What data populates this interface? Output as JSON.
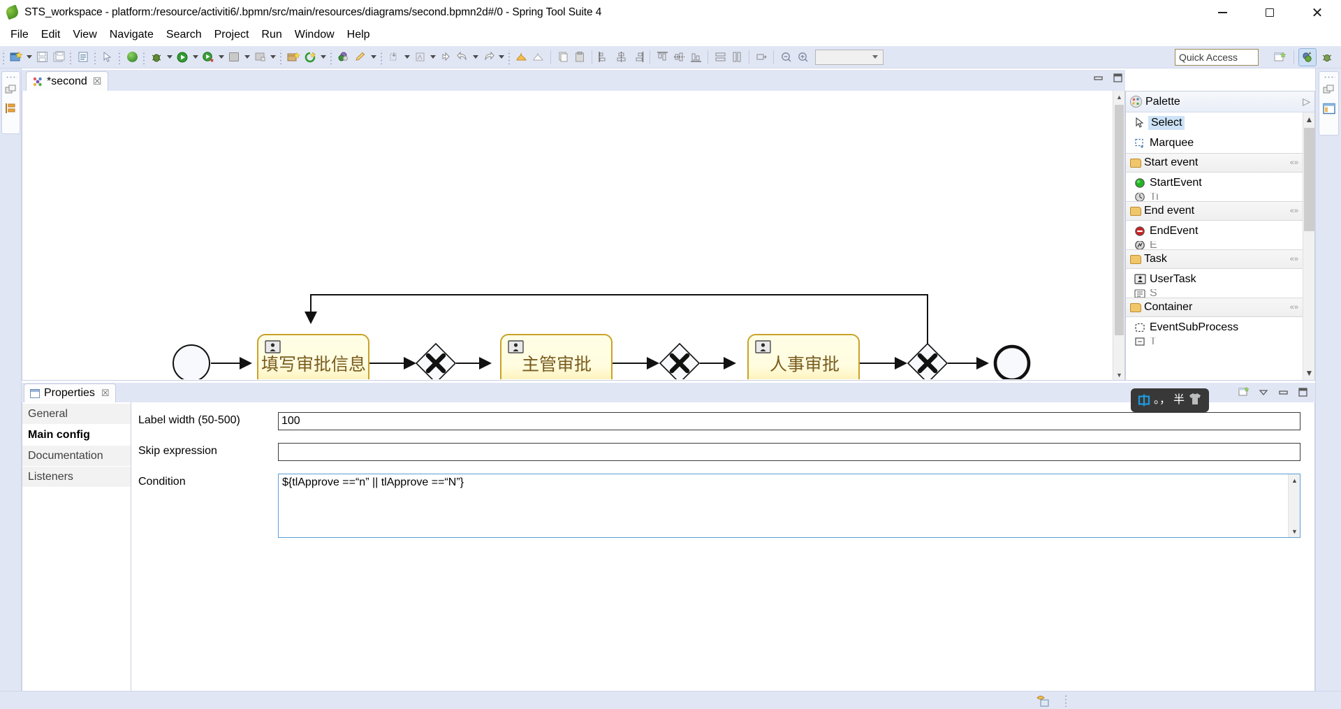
{
  "window": {
    "title": "STS_workspace - platform:/resource/activiti6/.bpmn/src/main/resources/diagrams/second.bpmn2d#/0 - Spring Tool Suite 4",
    "app_icon": "spring-leaf-icon",
    "minimize_label": "Minimize",
    "maximize_label": "Restore",
    "close_label": "Close"
  },
  "menubar": {
    "items": [
      {
        "label": "File"
      },
      {
        "label": "Edit"
      },
      {
        "label": "View"
      },
      {
        "label": "Navigate"
      },
      {
        "label": "Search"
      },
      {
        "label": "Project"
      },
      {
        "label": "Run"
      },
      {
        "label": "Window"
      },
      {
        "label": "Help"
      }
    ]
  },
  "toolbar": {
    "quick_access_placeholder": "Quick Access",
    "zoom_combo_value": "",
    "perspective_icons": [
      "open-perspective-icon",
      "spring-perspective-icon",
      "debug-perspective-icon"
    ]
  },
  "editor": {
    "tab_label": "*second",
    "tab_icon": "bpmn-diagram-icon",
    "tab_close": "☒",
    "minimize_label": "Minimize",
    "maximize_label": "Maximize"
  },
  "diagram": {
    "type": "bpmn-process",
    "nodes": [
      {
        "id": "startEvent1",
        "kind": "start-event",
        "label": ""
      },
      {
        "id": "usertask1",
        "kind": "user-task",
        "label": "填写审批信息"
      },
      {
        "id": "gateway1",
        "kind": "exclusive-gateway",
        "label": ""
      },
      {
        "id": "usertask2",
        "kind": "user-task",
        "label": "主管审批"
      },
      {
        "id": "gateway2",
        "kind": "exclusive-gateway",
        "label": ""
      },
      {
        "id": "usertask3",
        "kind": "user-task",
        "label": "人事审批"
      },
      {
        "id": "gateway3",
        "kind": "exclusive-gateway",
        "label": ""
      },
      {
        "id": "endEvent1",
        "kind": "end-event",
        "label": ""
      },
      {
        "id": "endEvent2",
        "kind": "end-event",
        "label": ""
      }
    ],
    "selected_flow": {
      "id": "selected-sequence-flow",
      "color": "#ff8c00",
      "style": "dashed",
      "from": "gateway2",
      "to": "usertask1"
    }
  },
  "palette": {
    "title": "Palette",
    "title_icon": "palette-icon",
    "expand_icon": "▷",
    "tools": [
      {
        "label": "Select",
        "icon": "cursor-arrow-icon",
        "selected": true
      },
      {
        "label": "Marquee",
        "icon": "marquee-select-icon",
        "selected": false
      }
    ],
    "groups": [
      {
        "name": "Start event",
        "items": [
          {
            "label": "StartEvent",
            "icon": "start-event-icon"
          }
        ]
      },
      {
        "name": "End event",
        "items": [
          {
            "label": "EndEvent",
            "icon": "end-event-icon"
          }
        ]
      },
      {
        "name": "Task",
        "items": [
          {
            "label": "UserTask",
            "icon": "user-task-icon"
          }
        ]
      },
      {
        "name": "Container",
        "items": [
          {
            "label": "EventSubProcess",
            "icon": "event-subprocess-icon"
          }
        ]
      }
    ]
  },
  "properties": {
    "tab_label": "Properties",
    "tab_icon": "properties-view-icon",
    "tab_close": "☒",
    "side_tabs": [
      {
        "label": "General",
        "active": false
      },
      {
        "label": "Main config",
        "active": true
      },
      {
        "label": "Documentation",
        "active": false
      },
      {
        "label": "Listeners",
        "active": false
      }
    ],
    "fields": [
      {
        "label": "Label width (50-500)",
        "value": "100",
        "placeholder": "",
        "kind": "text"
      },
      {
        "label": "Skip expression",
        "value": "",
        "placeholder": "",
        "kind": "text"
      },
      {
        "label": "Condition",
        "value": "${tlApprove ==“n” || tlApprove ==“N”}",
        "placeholder": "",
        "kind": "textarea"
      }
    ]
  },
  "ime": {
    "mode": "中",
    "punctuation": "。，",
    "width_mode": "半",
    "skin": "shirt-icon"
  },
  "statusbar": {
    "icon": "remote-system-icon",
    "text": ""
  },
  "colors": {
    "toolbar_bg": "#e1e6f5",
    "task_fill_top": "#ffffe0",
    "task_fill_bottom": "#ffeda0",
    "task_stroke": "#c9a227",
    "task_text": "#7a5c1e",
    "selection_orange": "#ff8c00",
    "tab_selected_bg": "#cde3f7",
    "accent_blue": "#5a9fd4"
  }
}
